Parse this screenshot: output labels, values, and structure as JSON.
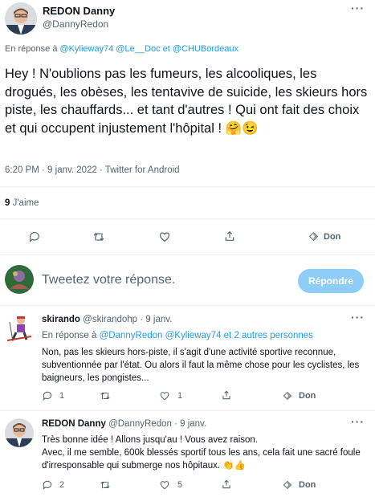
{
  "main_tweet": {
    "author_name": "REDON Danny",
    "author_handle": "@DannyRedon",
    "reply_prefix": "En réponse à",
    "reply_to": [
      "@Kylieway74",
      "@Le__Doc",
      "et",
      "@CHUBordeaux"
    ],
    "text": "Hey ! N'oublions pas les fumeurs, les alcooliques, les drogués, les obèses, les tentavive de suicide, les skieurs hors piste, les chauffards... et tant d'autres ! Qui ont fait des choix et qui occupent injustement l'hôpital ! 🤗😉",
    "meta": "6:20 PM · 9 janv. 2022 · Twitter for Android",
    "likes_count": "9",
    "likes_label": "J'aime",
    "share_label": "Don"
  },
  "compose": {
    "placeholder": "Tweetez votre réponse.",
    "button_label": "Répondre"
  },
  "replies": [
    {
      "author_name": "skirando",
      "author_handle": "@skirandohp",
      "time": "· 9 janv.",
      "reply_prefix": "En réponse à",
      "reply_to": "@DannyRedon @Kylieway74",
      "reply_and": "et",
      "reply_more": "2 autres personnes",
      "text": "Non, pas les skieurs hors-piste, il s'agit d'une activité sportive reconnue, subventionnée par l'état. Ou alors il faut la même chose pour les cyclistes, les baigneurs, les pongistes...",
      "reply_count": "1",
      "like_count": "1",
      "share_label": "Don"
    },
    {
      "author_name": "REDON Danny",
      "author_handle": "@DannyRedon",
      "time": "· 9 janv.",
      "text_line1": "Très bonne idée ! Allons jusqu'au ! Vous avez raison.",
      "text_line2": "Avec, il me semble, 600k blessés sportif tous les ans, cela fait une sacré foule d'irresponsable qui submerge nos hôpitaux. 👏👍",
      "reply_count": "2",
      "like_count": "5",
      "share_label": "Don"
    }
  ],
  "colors": {
    "accent": "#1d9bf0",
    "muted": "#536471",
    "button_disabled": "#8ecdf8"
  }
}
